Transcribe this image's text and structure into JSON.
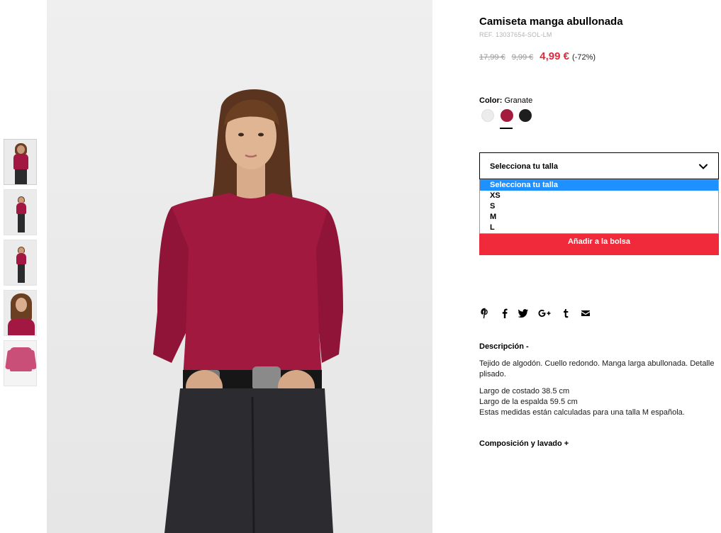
{
  "thumbnails": [
    {
      "name": "thumb-front",
      "active": true
    },
    {
      "name": "thumb-full"
    },
    {
      "name": "thumb-side"
    },
    {
      "name": "thumb-closeup"
    },
    {
      "name": "thumb-flat"
    }
  ],
  "product": {
    "title": "Camiseta manga abullonada",
    "ref": "REF. 13037654-SOL-LM",
    "price_original": "17,99 €",
    "price_previous": "9,99 €",
    "price_now": "4,99 €",
    "discount": "(-72%)"
  },
  "color": {
    "label": "Color:",
    "selected": "Granate",
    "swatches": [
      "#ececec",
      "#a41c3d",
      "#1e1e1e"
    ],
    "selected_index": 1
  },
  "size": {
    "placeholder": "Selecciona tu talla",
    "options": [
      "Selecciona tu talla",
      "XS",
      "S",
      "M",
      "L"
    ],
    "highlighted_index": 0
  },
  "add_to_bag": "Añadir a la bolsa",
  "social_icons": [
    "pinterest-icon",
    "facebook-icon",
    "twitter-icon",
    "google-plus-icon",
    "tumblr-icon",
    "email-icon"
  ],
  "description": {
    "title": "Descripción -",
    "paragraph1": "Tejido de algodón. Cuello redondo. Manga larga abullonada. Detalle plisado.",
    "line1": "Largo de costado 38.5 cm",
    "line2": "Largo de la espalda 59.5 cm",
    "line3": "Estas medidas están calculadas para una talla M española."
  },
  "composition_title": "Composición y lavado +",
  "colors": {
    "accent_red": "#f02a3b",
    "price_red": "#e4283a",
    "highlight_blue": "#1e90ff"
  }
}
